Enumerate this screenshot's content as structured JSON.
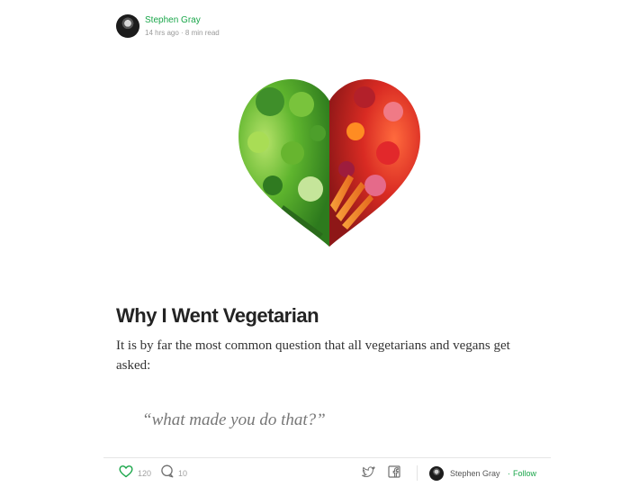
{
  "header": {
    "author_name": "Stephen Gray",
    "meta": "14 hrs ago · 8 min read"
  },
  "article": {
    "title": "Why I Went Vegetarian",
    "body": "It is by far the most common question that all vegetarians and vegans get asked:",
    "quote": "“what made you do that?”"
  },
  "footer": {
    "like_count": "120",
    "comment_count": "10",
    "author_name": "Stephen Gray",
    "separator": "·",
    "follow_label": "Follow"
  },
  "icons": {
    "like": "heart-icon",
    "comment": "comment-icon",
    "twitter": "twitter-icon",
    "facebook": "facebook-icon"
  },
  "colors": {
    "accent": "#1aa64a",
    "muted": "#9a9a9a"
  }
}
